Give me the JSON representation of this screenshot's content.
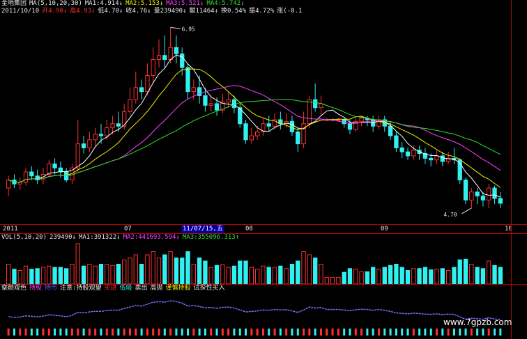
{
  "header": {
    "row1": [
      {
        "text": "金地集团",
        "cls": "w"
      },
      {
        "text": "MA(5,10,20,30)",
        "cls": "w"
      },
      {
        "text": "MA1:4.914↓",
        "cls": "w"
      },
      {
        "text": "MA2:5.153↓",
        "cls": "y"
      },
      {
        "text": "MA3:5.521↓",
        "cls": "m"
      },
      {
        "text": "MA4:5.742↓",
        "cls": "g"
      }
    ],
    "row2": [
      {
        "text": "2011/10/10",
        "cls": "w"
      },
      {
        "text": "开4.90↓",
        "cls": "r"
      },
      {
        "text": "高4.93↓",
        "cls": "r"
      },
      {
        "text": "低4.70↓",
        "cls": "w"
      },
      {
        "text": "收4.76↓",
        "cls": "w"
      },
      {
        "text": "量239490↓",
        "cls": "w"
      },
      {
        "text": "额11464↓",
        "cls": "w"
      },
      {
        "text": "换0.54%",
        "cls": "w"
      },
      {
        "text": "振4.72%",
        "cls": "w"
      },
      {
        "text": "涨(-0.1",
        "cls": "w"
      }
    ]
  },
  "price_labels": {
    "high": "6.95",
    "low": "4.70"
  },
  "time_axis": {
    "ticks": [
      {
        "label": "2011",
        "pos": "left"
      },
      {
        "label": "07",
        "pos": "a"
      },
      {
        "label": "08",
        "pos": "b"
      },
      {
        "label": "09",
        "pos": "c"
      },
      {
        "label": "10",
        "pos": "d"
      }
    ],
    "cursor_date": "11/07/15,五"
  },
  "volume_header": [
    {
      "text": "VOL(5,10,20)",
      "cls": "w"
    },
    {
      "text": "239490↓",
      "cls": "w"
    },
    {
      "text": "MA1:391322↓",
      "cls": "w"
    },
    {
      "text": "MA2:441693.594↓",
      "cls": "m"
    },
    {
      "text": "MA3:355096.313↑",
      "cls": "g"
    }
  ],
  "indicator_header": [
    {
      "text": "察颜观色",
      "cls": "w"
    },
    {
      "text": "持股",
      "cls": "m"
    },
    {
      "text": "持币",
      "cls": "b"
    },
    {
      "text": "注意:持股观望",
      "cls": "w"
    },
    {
      "text": "买进",
      "cls": "r"
    },
    {
      "text": "低吸",
      "cls": "c"
    },
    {
      "text": "卖出",
      "cls": "w"
    },
    {
      "text": "高抛",
      "cls": "w"
    },
    {
      "text": "谨慎持股",
      "cls": "y"
    },
    {
      "text": "试探性买入",
      "cls": "w"
    }
  ],
  "watermark": "www.7gpzb.com",
  "colors": {
    "up": "#ff3030",
    "down": "#30f0f0",
    "ma1": "#ffffff",
    "ma2": "#f0f000",
    "ma3": "#ff40ff",
    "ma4": "#30e030",
    "frame": "#b00000"
  },
  "chart_data": {
    "type": "candlestick",
    "ylim": [
      4.5,
      7.1
    ],
    "candles": [
      [
        4.95,
        5.05,
        4.85,
        5.1
      ],
      [
        5.05,
        5.0,
        4.95,
        5.12
      ],
      [
        5.0,
        5.02,
        4.93,
        5.08
      ],
      [
        5.02,
        5.15,
        4.98,
        5.2
      ],
      [
        5.15,
        5.1,
        5.05,
        5.22
      ],
      [
        5.1,
        5.05,
        5.0,
        5.18
      ],
      [
        5.05,
        5.12,
        5.0,
        5.2
      ],
      [
        5.12,
        5.25,
        5.08,
        5.3
      ],
      [
        5.25,
        5.2,
        5.12,
        5.32
      ],
      [
        5.2,
        5.15,
        5.08,
        5.28
      ],
      [
        5.15,
        5.05,
        5.02,
        5.2
      ],
      [
        5.05,
        5.2,
        5.0,
        5.25
      ],
      [
        5.2,
        5.5,
        5.15,
        5.8
      ],
      [
        5.5,
        5.45,
        5.38,
        5.6
      ],
      [
        5.45,
        5.55,
        5.4,
        5.65
      ],
      [
        5.55,
        5.62,
        5.48,
        5.7
      ],
      [
        5.62,
        5.6,
        5.5,
        5.75
      ],
      [
        5.6,
        5.7,
        5.55,
        5.8
      ],
      [
        5.7,
        5.75,
        5.62,
        5.85
      ],
      [
        5.75,
        5.72,
        5.65,
        5.9
      ],
      [
        5.72,
        5.9,
        5.68,
        6.0
      ],
      [
        5.9,
        6.05,
        5.85,
        6.2
      ],
      [
        6.05,
        6.2,
        6.0,
        6.4
      ],
      [
        6.2,
        6.15,
        6.05,
        6.3
      ],
      [
        6.15,
        6.35,
        6.1,
        6.5
      ],
      [
        6.35,
        6.55,
        6.25,
        6.7
      ],
      [
        6.55,
        6.6,
        6.45,
        6.8
      ],
      [
        6.6,
        6.55,
        6.45,
        6.85
      ],
      [
        6.55,
        6.7,
        6.5,
        6.95
      ],
      [
        6.7,
        6.62,
        6.5,
        6.85
      ],
      [
        6.62,
        6.45,
        6.35,
        6.7
      ],
      [
        6.45,
        6.15,
        6.05,
        6.5
      ],
      [
        6.15,
        6.2,
        6.05,
        6.3
      ],
      [
        6.2,
        6.1,
        6.0,
        6.35
      ],
      [
        6.1,
        5.98,
        5.9,
        6.2
      ],
      [
        5.98,
        6.0,
        5.9,
        6.1
      ],
      [
        6.0,
        5.92,
        5.85,
        6.08
      ],
      [
        5.92,
        6.02,
        5.88,
        6.12
      ],
      [
        6.02,
        6.05,
        5.95,
        6.15
      ],
      [
        6.05,
        5.95,
        5.88,
        6.1
      ],
      [
        5.95,
        5.75,
        5.7,
        6.0
      ],
      [
        5.75,
        5.55,
        5.5,
        5.8
      ],
      [
        5.55,
        5.6,
        5.5,
        5.7
      ],
      [
        5.6,
        5.65,
        5.55,
        5.72
      ],
      [
        5.65,
        5.75,
        5.6,
        5.82
      ],
      [
        5.75,
        5.72,
        5.65,
        5.85
      ],
      [
        5.72,
        5.8,
        5.68,
        5.88
      ],
      [
        5.8,
        5.75,
        5.68,
        5.9
      ],
      [
        5.75,
        5.78,
        5.7,
        5.88
      ],
      [
        5.78,
        5.65,
        5.6,
        5.85
      ],
      [
        5.65,
        5.5,
        5.4,
        5.7
      ],
      [
        5.5,
        5.75,
        5.45,
        5.9
      ],
      [
        5.75,
        6.05,
        5.7,
        6.1
      ],
      [
        6.05,
        5.95,
        5.9,
        6.25
      ],
      [
        5.95,
        6.0,
        5.85,
        6.1
      ],
      [
        5.8,
        5.8,
        5.78,
        5.82
      ],
      [
        5.8,
        5.8,
        5.78,
        5.82
      ],
      [
        5.8,
        5.8,
        5.78,
        5.82
      ],
      [
        5.8,
        5.75,
        5.7,
        5.82
      ],
      [
        5.75,
        5.68,
        5.62,
        5.8
      ],
      [
        5.68,
        5.78,
        5.65,
        5.82
      ],
      [
        5.78,
        5.82,
        5.72,
        5.85
      ],
      [
        5.82,
        5.8,
        5.72,
        5.85
      ],
      [
        5.8,
        5.72,
        5.65,
        5.85
      ],
      [
        5.72,
        5.8,
        5.68,
        5.85
      ],
      [
        5.8,
        5.72,
        5.65,
        5.85
      ],
      [
        5.72,
        5.6,
        5.55,
        5.78
      ],
      [
        5.6,
        5.45,
        5.4,
        5.65
      ],
      [
        5.45,
        5.4,
        5.32,
        5.52
      ],
      [
        5.4,
        5.35,
        5.3,
        5.45
      ],
      [
        5.35,
        5.42,
        5.3,
        5.48
      ],
      [
        5.42,
        5.38,
        5.3,
        5.48
      ],
      [
        5.38,
        5.32,
        5.25,
        5.45
      ],
      [
        5.32,
        5.3,
        5.22,
        5.38
      ],
      [
        5.3,
        5.35,
        5.25,
        5.42
      ],
      [
        5.35,
        5.28,
        5.22,
        5.4
      ],
      [
        5.28,
        5.32,
        5.25,
        5.4
      ],
      [
        5.32,
        5.3,
        5.25,
        5.45
      ],
      [
        5.3,
        5.05,
        5.0,
        5.32
      ],
      [
        5.05,
        4.8,
        4.75,
        5.08
      ],
      [
        4.8,
        4.9,
        4.7,
        4.95
      ],
      [
        4.9,
        4.85,
        4.75,
        4.95
      ],
      [
        4.85,
        4.8,
        4.72,
        4.9
      ],
      [
        4.8,
        4.95,
        4.7,
        5.0
      ],
      [
        4.95,
        4.82,
        4.75,
        4.98
      ],
      [
        4.82,
        4.76,
        4.7,
        4.9
      ]
    ]
  }
}
